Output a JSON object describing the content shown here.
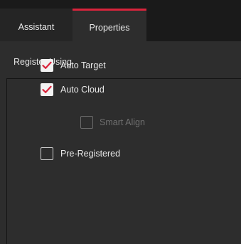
{
  "tabs": [
    {
      "label": "Assistant",
      "active": false
    },
    {
      "label": "Properties",
      "active": true
    }
  ],
  "section": {
    "title": "Register Using"
  },
  "options": {
    "auto_target": {
      "label": "Auto Target",
      "checked": true,
      "enabled": true
    },
    "auto_cloud": {
      "label": "Auto Cloud",
      "checked": true,
      "enabled": true
    },
    "smart_align": {
      "label": "Smart Align",
      "checked": false,
      "enabled": false
    },
    "pre_registered": {
      "label": "Pre-Registered",
      "checked": false,
      "enabled": true
    }
  },
  "colors": {
    "accent": "#d9243c",
    "background": "#2d2d2d",
    "tab_inactive": "#252525",
    "text": "#e8e8e8",
    "text_disabled": "#707070"
  }
}
